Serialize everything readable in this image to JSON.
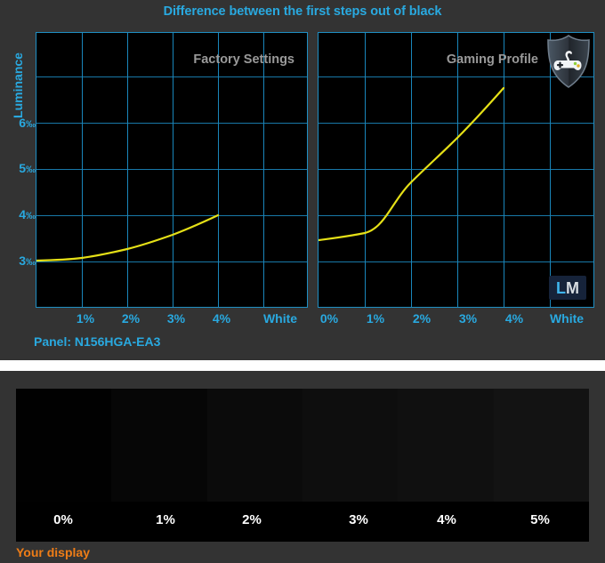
{
  "title": "Difference between the first steps out of black",
  "colors": {
    "accent_blue": "#29a9e0",
    "grid_blue": "#1878a8",
    "curve_yellow": "#e5e017",
    "caption_gray": "#9a9a9a",
    "orange": "#ef7d17",
    "panel_bg": "#333333",
    "plot_bg": "#000000"
  },
  "axis": {
    "y_label": "Luminance",
    "y_ticks": [
      "3",
      "4",
      "5",
      "6"
    ],
    "y_unit": "‰"
  },
  "left_chart": {
    "caption": "Factory Settings",
    "x_ticks": [
      "1%",
      "2%",
      "3%",
      "4%",
      "White"
    ]
  },
  "right_chart": {
    "caption": "Gaming Profile",
    "x_ticks": [
      "0%",
      "1%",
      "2%",
      "3%",
      "4%",
      "White"
    ],
    "badge_icon": "shield-gamepad-icon",
    "watermark_l": "L",
    "watermark_m": "M"
  },
  "panel_info": "Panel: N156HGA-EA3",
  "bottom": {
    "your_display": "Your display",
    "step_labels": [
      "0%",
      "1%",
      "2%",
      "3%",
      "4%",
      "5%"
    ],
    "step_colors": [
      "#010101",
      "#060606",
      "#0b0b0b",
      "#0e0e0e",
      "#101010",
      "#131313"
    ]
  },
  "chart_data": [
    {
      "type": "line",
      "title": "Factory Settings",
      "subtitle": "Difference between the first steps out of black",
      "xlabel": "",
      "ylabel": "Luminance",
      "y_unit": "‰",
      "x": [
        "0%",
        "1%",
        "2%",
        "3%",
        "4%",
        "White"
      ],
      "x_tick_labels_shown": [
        "1%",
        "2%",
        "3%",
        "4%",
        "White"
      ],
      "ylim": [
        1.0,
        7.5
      ],
      "y_ticks": [
        3,
        4,
        5,
        6
      ],
      "grid": true,
      "legend": "none",
      "series": [
        {
          "name": "Factory Settings",
          "color": "#e5e017",
          "x": [
            0,
            1,
            2,
            3,
            4
          ],
          "values": [
            3.0,
            3.06,
            3.18,
            3.34,
            3.55
          ]
        }
      ]
    },
    {
      "type": "line",
      "title": "Gaming Profile",
      "subtitle": "Difference between the first steps out of black",
      "xlabel": "",
      "ylabel": "Luminance",
      "y_unit": "‰",
      "x": [
        "0%",
        "1%",
        "2%",
        "3%",
        "4%",
        "White"
      ],
      "x_tick_labels_shown": [
        "0%",
        "1%",
        "2%",
        "3%",
        "4%",
        "White"
      ],
      "ylim": [
        1.0,
        7.5
      ],
      "y_ticks": [
        3,
        4,
        5,
        6
      ],
      "grid": true,
      "legend": "none",
      "series": [
        {
          "name": "Gaming Profile",
          "color": "#e5e017",
          "x": [
            0,
            1,
            2,
            3,
            4
          ],
          "values": [
            3.45,
            3.72,
            4.55,
            5.3,
            6.2
          ]
        }
      ]
    },
    {
      "type": "heatmap",
      "title": "Your display",
      "orientation": "horizontal-gradient-steps",
      "categories": [
        "0%",
        "1%",
        "2%",
        "3%",
        "4%",
        "5%"
      ],
      "values": [
        1,
        6,
        11,
        14,
        16,
        19
      ],
      "value_note": "8-bit grey level of each step patch"
    }
  ]
}
